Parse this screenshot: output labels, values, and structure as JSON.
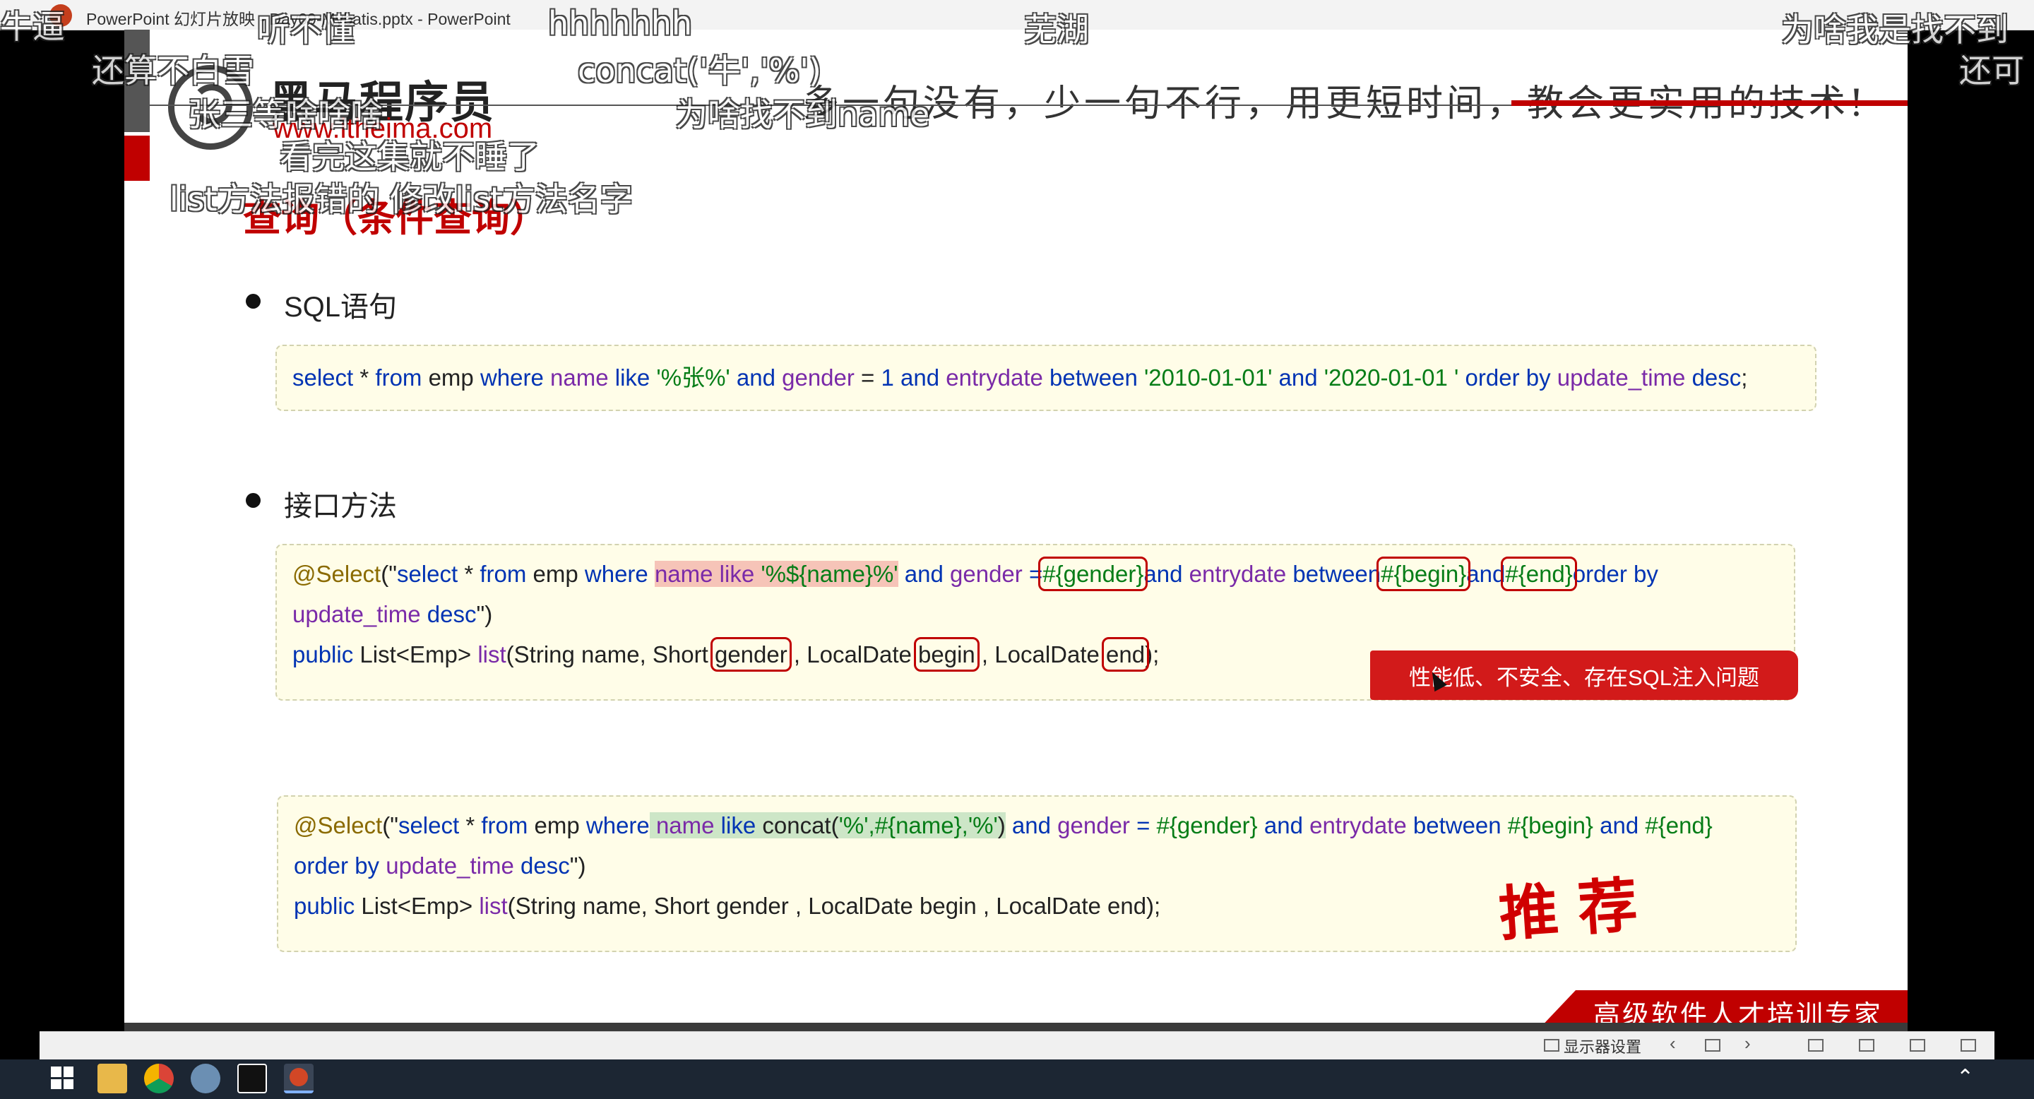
{
  "titlebar": {
    "app": "PowerPoint 幻灯片放映",
    "sep": " - ",
    "file": "Day09-Mybatis.pptx",
    "program": "PowerPoint"
  },
  "slide": {
    "logo_name": "黑马程序员",
    "logo_url": "www.itheima.com",
    "slogan": "多一句没有，少一句不行，用更短时间，教会更实用的技术!",
    "title": "查询（条件查询）",
    "sections": [
      {
        "label": "SQL语句"
      },
      {
        "label": "接口方法"
      }
    ],
    "sql": {
      "t1": "select",
      "t2": " * ",
      "t3": "from",
      "t4": " emp ",
      "t5": "where",
      "t6": " name ",
      "t7": "like",
      "t8": " '%张%' ",
      "t9": "and",
      "t10": " gender ",
      "t11": "= ",
      "t12": "1",
      "t13": " and",
      "t14": " entrydate ",
      "t15": "between",
      "t16": " '2010-01-01' ",
      "t17": "and",
      "t18": " '2020-01-01 ' ",
      "t19": "order by",
      "t20": " update_time ",
      "t21": "desc",
      "t22": ";"
    },
    "code1": {
      "ann": "@Select",
      "p1": "(\"",
      "k1": "select",
      "s1": " * ",
      "k2": "from",
      "s2": " emp ",
      "k3": "where",
      "h_name": "name",
      "h_like": " like ",
      "h_val": "'%${name}%'",
      "k4": " and",
      "f1": " gender ",
      "k5": "=",
      "b_gender": "#{gender}",
      "k6": "and",
      "f2": " entrydate ",
      "k7": "between",
      "b_begin": "#{begin}",
      "k8": "and",
      "b_end": "#{end}",
      "k9": "order by",
      "l2_field": "update_time",
      "l2_desc": " desc",
      "l2_end": "\")",
      "l3_public": "public",
      "l3_type": " List<Emp> ",
      "l3_method": "list",
      "l3_args1": "(String name, Short ",
      "l3_gender": "gender",
      "l3_args2": " , LocalDate ",
      "l3_begin": "begin",
      "l3_args3": " , LocalDate ",
      "l3_end": "end",
      "l3_close": ");"
    },
    "warning": "性能低、不安全、存在SQL注入问题",
    "code2": {
      "ann": "@Select",
      "p1": "(\"",
      "k1": "select",
      "s1": " * ",
      "k2": "from",
      "s2": " emp ",
      "k3": "where",
      "h_name": " name ",
      "h_like": "like",
      "h_concat": "  concat(",
      "h_args": "'%',#{name},'%'",
      "h_close": ")",
      "k4": " and",
      "f1": " gender ",
      "k5": "=",
      "v1": " #{gender} ",
      "k6": "and",
      "f2": " entrydate ",
      "k7": "between",
      "v2": " #{begin} ",
      "k8": "and",
      "v3": " #{end}",
      "l2_order": "order by",
      "l2_field": " update_time ",
      "l2_desc": "desc",
      "l2_end": "\")",
      "l3_public": "public",
      "l3_type": " List<Emp> ",
      "l3_method": "list",
      "l3_rest": "(String name, Short gender , LocalDate begin , LocalDate end);"
    },
    "recommend": "推荐",
    "footer": "高级软件人才培训专家"
  },
  "statusbar": {
    "display_settings": "显示器设置"
  },
  "taskbar": {
    "apps": [
      "start-icon",
      "file-explorer-icon",
      "chrome-icon",
      "app-icon",
      "intellij-icon",
      "powerpoint-icon"
    ]
  },
  "danmaku": [
    "牛逼",
    "听不懂",
    "还算不白雪",
    "张三等啥啥啥",
    "看完这集就不睡了",
    "list方法报错的 修改list方法名字",
    "hhhhhhh",
    "concat('牛','%')",
    "为啥找不到name",
    "芜湖",
    "为啥我是找不到",
    "还可"
  ]
}
